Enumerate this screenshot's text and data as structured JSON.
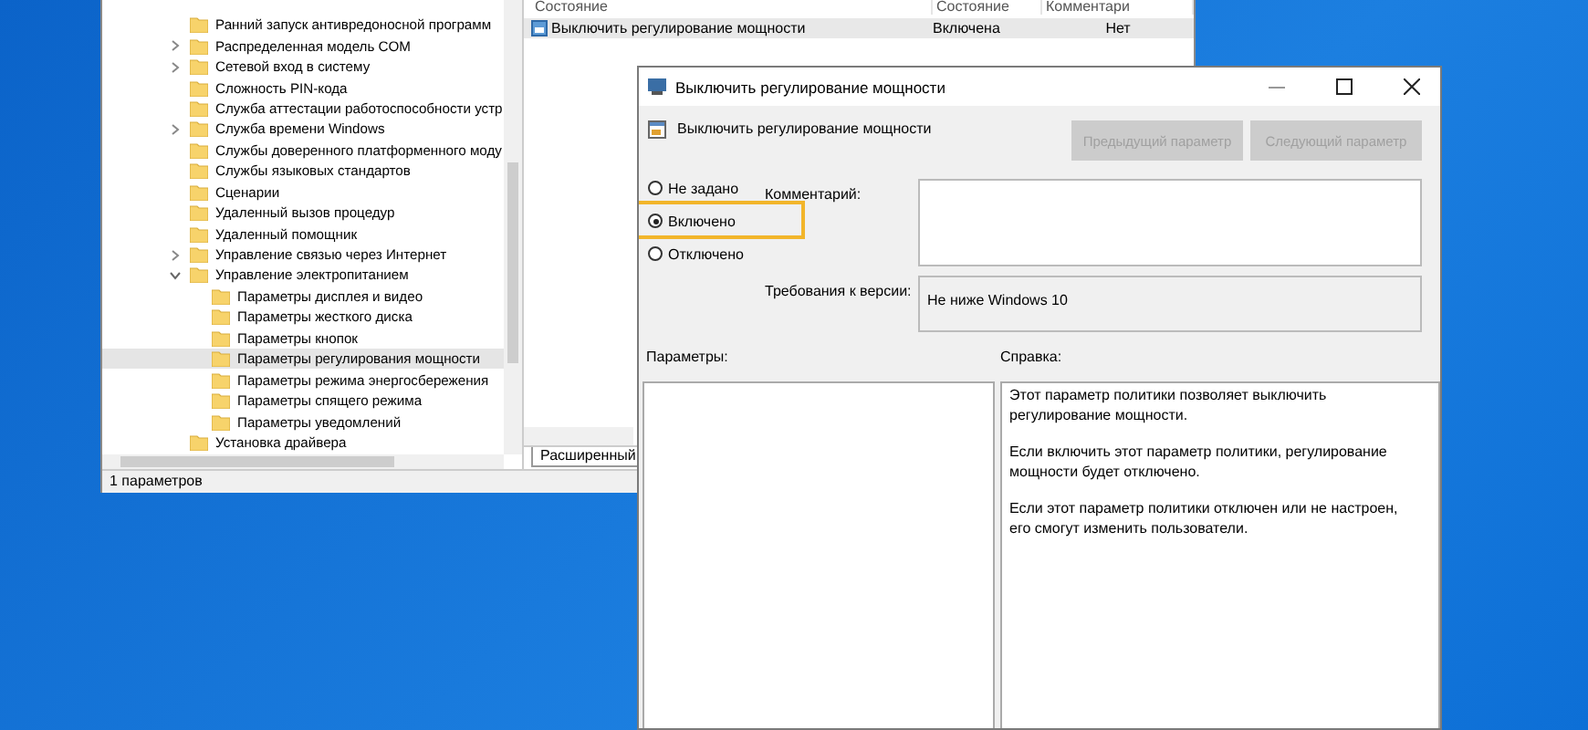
{
  "editor": {
    "list": {
      "columns": [
        "Состояние",
        "Состояние",
        "Комментари"
      ],
      "rows": [
        {
          "name": "Выключить регулирование мощности",
          "state": "Включена",
          "comment": "Нет",
          "selected": true
        }
      ]
    },
    "tree": [
      {
        "label": "Ранний запуск антивредоносной программ",
        "selected": false
      },
      {
        "label": "Распределенная модель COM",
        "expanded": false,
        "selected": false
      },
      {
        "label": "Сетевой вход в систему",
        "expanded": false,
        "selected": false
      },
      {
        "label": "Сложность PIN-кода",
        "selected": false
      },
      {
        "label": "Служба аттестации работоспособности устр",
        "selected": false
      },
      {
        "label": "Служба времени Windows",
        "expanded": false,
        "selected": false
      },
      {
        "label": "Службы доверенного платформенного моду",
        "selected": false
      },
      {
        "label": "Службы языковых стандартов",
        "selected": false
      },
      {
        "label": "Сценарии",
        "selected": false
      },
      {
        "label": "Удаленный вызов процедур",
        "selected": false
      },
      {
        "label": "Удаленный помощник",
        "selected": false
      },
      {
        "label": "Управление связью через Интернет",
        "expanded": false,
        "selected": false
      },
      {
        "label": "Управление электропитанием",
        "expanded": true,
        "selected": false,
        "children": [
          {
            "label": "Параметры дисплея и видео",
            "selected": false
          },
          {
            "label": "Параметры жесткого диска",
            "selected": false
          },
          {
            "label": "Параметры кнопок",
            "selected": false
          },
          {
            "label": "Параметры регулирования мощности",
            "selected": true
          },
          {
            "label": "Параметры режима энергосбережения",
            "selected": false
          },
          {
            "label": "Параметры спящего режима",
            "selected": false
          },
          {
            "label": "Параметры уведомлений",
            "selected": false
          }
        ]
      },
      {
        "label": "Установка драйвера",
        "selected": false
      }
    ],
    "tabs": [
      {
        "label": "Расширенный",
        "selected": true
      }
    ],
    "status_bar": "1 параметров"
  },
  "dialog": {
    "title": "Выключить регулирование мощности",
    "setting_name": "Выключить регулирование мощности",
    "buttons": [
      {
        "label": "Предыдущий параметр",
        "disabled": true
      },
      {
        "label": "Следующий параметр",
        "disabled": true
      }
    ],
    "options": [
      {
        "label": "Не задано",
        "selected": false,
        "highlighted": false
      },
      {
        "label": "Включено",
        "selected": true,
        "highlighted": true
      },
      {
        "label": "Отключено",
        "selected": false,
        "highlighted": false
      }
    ],
    "comment_label": "Комментарий:",
    "requirements_label": "Требования к версии:",
    "requirements": "Не ниже Windows 10",
    "options_label": "Параметры:",
    "help_label": "Справка:",
    "help": [
      "Этот параметр политики позволяет выключить регулирование мощности.",
      "Если включить этот параметр политики, регулирование мощности будет отключено.",
      "Если этот параметр политики отключен или не настроен, его смогут изменить пользователи."
    ]
  }
}
